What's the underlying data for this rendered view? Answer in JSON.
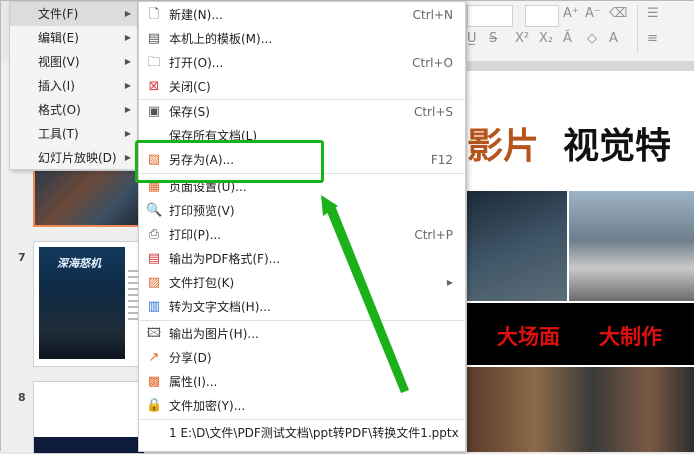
{
  "main_menu": [
    {
      "label": "文件(F)",
      "selected": true
    },
    {
      "label": "编辑(E)"
    },
    {
      "label": "视图(V)"
    },
    {
      "label": "插入(I)"
    },
    {
      "label": "格式(O)"
    },
    {
      "label": "工具(T)"
    },
    {
      "label": "幻灯片放映(D)"
    }
  ],
  "file_menu": [
    {
      "icon": "new-file-icon",
      "label": "新建(N)...",
      "shortcut": "Ctrl+N"
    },
    {
      "icon": "template-icon",
      "label": "本机上的模板(M)...",
      "shortcut": ""
    },
    {
      "icon": "open-folder-icon",
      "label": "打开(O)...",
      "shortcut": "Ctrl+O"
    },
    {
      "icon": "close-icon",
      "label": "关闭(C)",
      "shortcut": ""
    },
    {
      "icon": "save-icon",
      "label": "保存(S)",
      "shortcut": "Ctrl+S"
    },
    {
      "icon": "",
      "label": "保存所有文档(L)",
      "shortcut": ""
    },
    {
      "icon": "save-as-icon",
      "label": "另存为(A)...",
      "shortcut": "F12"
    },
    {
      "icon": "page-setup-icon",
      "label": "页面设置(U)...",
      "shortcut": ""
    },
    {
      "icon": "print-preview-icon",
      "label": "打印预览(V)",
      "shortcut": ""
    },
    {
      "icon": "print-icon",
      "label": "打印(P)...",
      "shortcut": "Ctrl+P"
    },
    {
      "icon": "pdf-icon",
      "label": "输出为PDF格式(F)...",
      "shortcut": ""
    },
    {
      "icon": "package-icon",
      "label": "文件打包(K)",
      "shortcut": ""
    },
    {
      "icon": "convert-text-icon",
      "label": "转为文字文档(H)...",
      "shortcut": ""
    },
    {
      "icon": "image-export-icon",
      "label": "输出为图片(H)...",
      "shortcut": ""
    },
    {
      "icon": "share-icon",
      "label": "分享(D)",
      "shortcut": ""
    },
    {
      "icon": "properties-icon",
      "label": "属性(I)...",
      "shortcut": ""
    },
    {
      "icon": "encrypt-icon",
      "label": "文件加密(Y)...",
      "shortcut": ""
    },
    {
      "icon": "",
      "label": "1 E:\\D\\文件\\PDF测试文档\\ppt转PDF\\转换文件1.pptx",
      "shortcut": ""
    }
  ],
  "slides": {
    "numbers": [
      "7",
      "8"
    ],
    "thumb7_title": "深海怒机"
  },
  "canvas": {
    "title_left": "影片",
    "title_right": "视觉特",
    "caption1": "大场面",
    "caption2": "大制作"
  },
  "colors": {
    "highlight": "#1bb11b",
    "title_orange": "#b5551b",
    "caption_red": "#e01010",
    "thumb_selected_border": "#f08a55"
  }
}
